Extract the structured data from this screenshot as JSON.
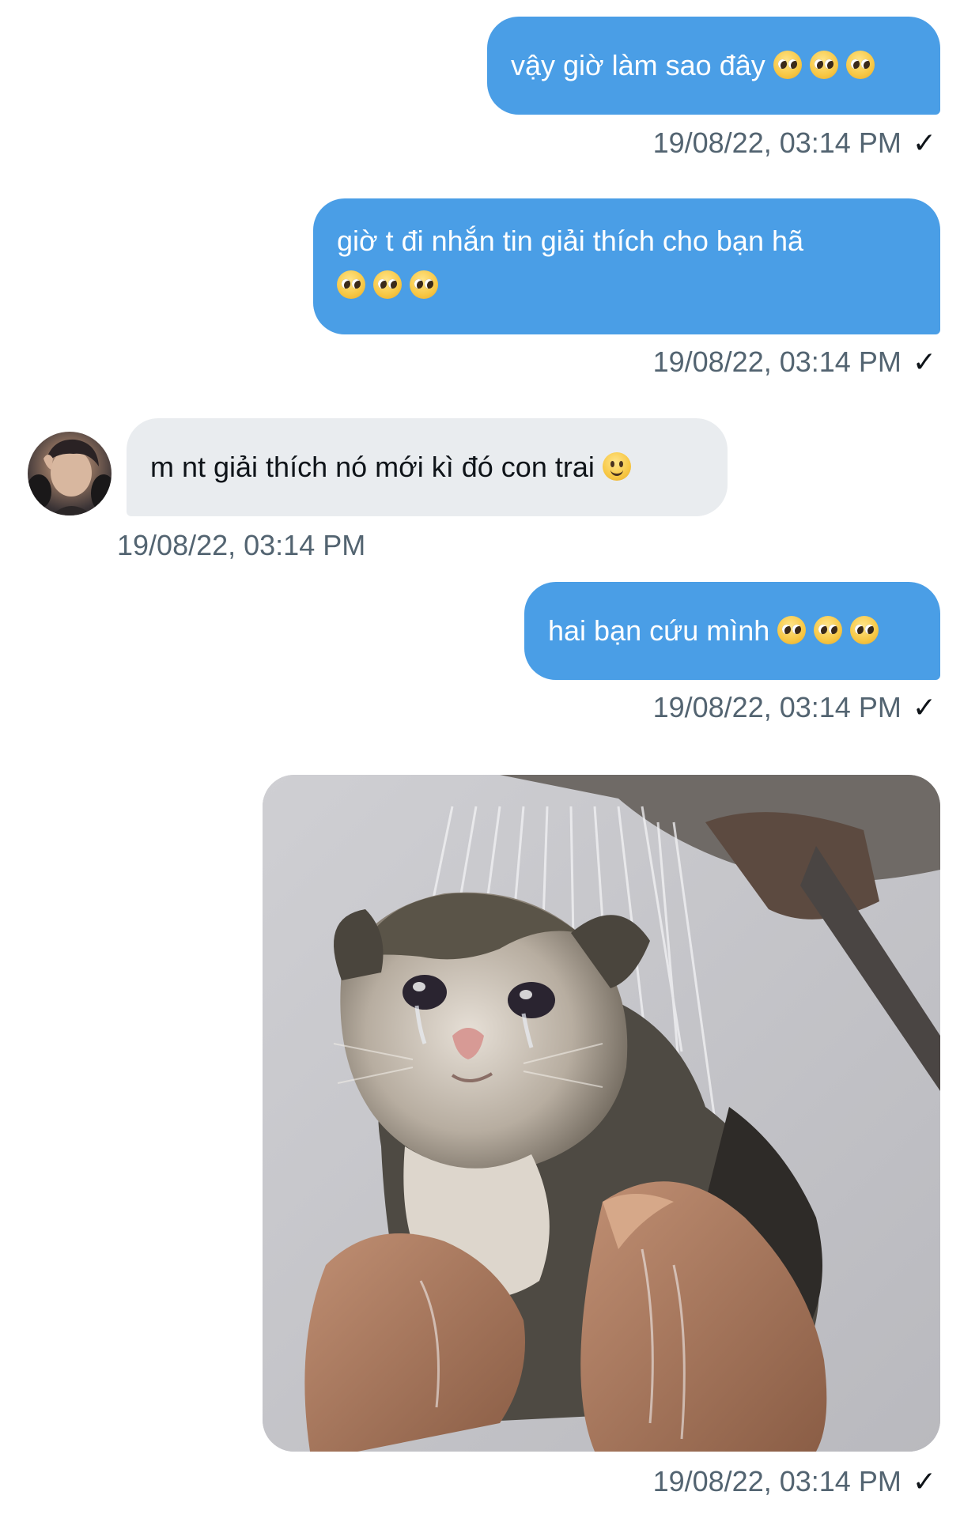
{
  "messages": [
    {
      "direction": "out",
      "text": "vậy giờ làm sao đây",
      "emojis": [
        "pleading-face",
        "pleading-face",
        "pleading-face"
      ],
      "timestamp": "19/08/22, 03:14 PM",
      "status": "✓"
    },
    {
      "direction": "out",
      "text": "giờ t đi nhắn tin giải thích cho bạn hã",
      "emojis": [
        "pleading-face",
        "pleading-face",
        "pleading-face"
      ],
      "timestamp": "19/08/22, 03:14 PM",
      "status": "✓"
    },
    {
      "direction": "in",
      "text": "m nt giải thích nó mới kì đó con trai",
      "emojis": [
        "slightly-smiling-face"
      ],
      "timestamp": "19/08/22, 03:14 PM"
    },
    {
      "direction": "out",
      "text": "hai bạn cứu mình",
      "emojis": [
        "pleading-face",
        "pleading-face",
        "pleading-face"
      ],
      "timestamp": "19/08/22, 03:14 PM",
      "status": "✓"
    },
    {
      "direction": "out",
      "type": "image",
      "image": "crying-wet-cat-meme",
      "timestamp": "19/08/22, 03:14 PM",
      "status": "✓"
    }
  ],
  "colors": {
    "outgoing_bubble": "#4a9ee6",
    "incoming_bubble": "#e9ecef",
    "timestamp": "#536471"
  }
}
